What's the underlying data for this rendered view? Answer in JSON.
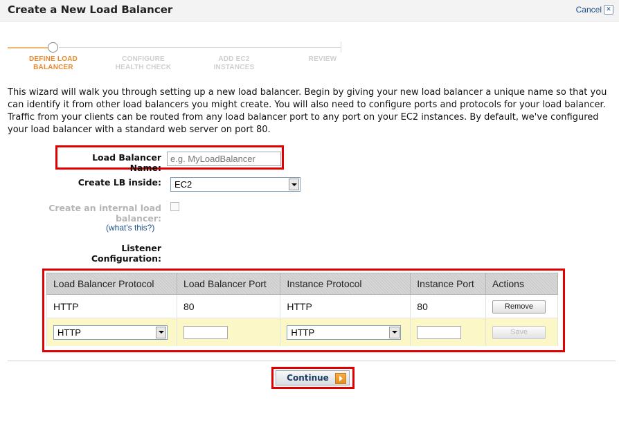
{
  "header": {
    "title": "Create a New Load Balancer",
    "cancel_label": "Cancel"
  },
  "wizard": {
    "steps": [
      {
        "line1": "DEFINE LOAD",
        "line2": "BALANCER",
        "active": true
      },
      {
        "line1": "CONFIGURE",
        "line2": "HEALTH CHECK",
        "active": false
      },
      {
        "line1": "ADD EC2",
        "line2": "INSTANCES",
        "active": false
      },
      {
        "line1": "REVIEW",
        "line2": "",
        "active": false
      }
    ]
  },
  "intro_text": "This wizard will walk you through setting up a new load balancer. Begin by giving your new load balancer a unique name so that you can identify it from other load balancers you might create. You will also need to configure ports and protocols for your load balancer. Traffic from your clients can be routed from any load balancer port to any port on your EC2 instances. By default, we've configured your load balancer with a standard web server on port 80.",
  "form": {
    "name_label": "Load Balancer Name:",
    "name_placeholder": "e.g. MyLoadBalancer",
    "name_value": "",
    "create_inside_label": "Create LB inside:",
    "create_inside_value": "EC2",
    "internal_label_line1": "Create an internal load",
    "internal_label_line2": "balancer:",
    "internal_checked": false,
    "internal_help": "(what's this?)",
    "listener_label_line1": "Listener",
    "listener_label_line2": "Configuration:"
  },
  "listeners": {
    "columns": [
      "Load Balancer Protocol",
      "Load Balancer Port",
      "Instance Protocol",
      "Instance Port",
      "Actions"
    ],
    "existing": {
      "lb_protocol": "HTTP",
      "lb_port": "80",
      "instance_protocol": "HTTP",
      "instance_port": "80",
      "action": "Remove"
    },
    "new_row": {
      "lb_protocol": "HTTP",
      "lb_port": "",
      "instance_protocol": "HTTP",
      "instance_port": "",
      "action": "Save"
    }
  },
  "continue_label": "Continue",
  "colors": {
    "highlight": "#e00000",
    "active_step": "#e8892e",
    "link": "#1a4f8b",
    "new_row_bg": "#fbf7c6"
  }
}
